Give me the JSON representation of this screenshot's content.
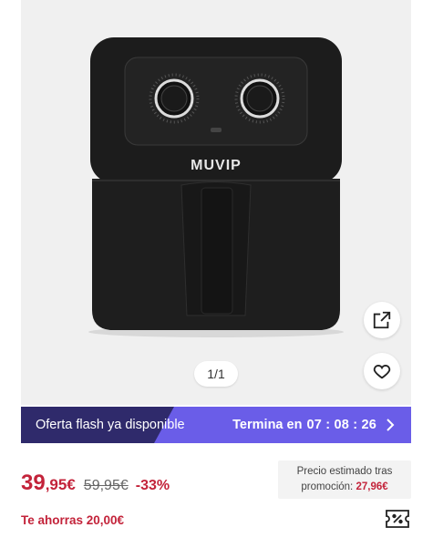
{
  "gallery": {
    "brand_logo_text": "MUVIP",
    "page_indicator": "1/1",
    "share_icon": "external-share-icon",
    "favorite_icon": "heart-outline-icon"
  },
  "flash": {
    "label": "Oferta flash ya disponible",
    "ends_label": "Termina en",
    "timer": "07 : 08 : 26",
    "accent_color": "#6a5de8"
  },
  "price": {
    "integer": "39",
    "decimal": ",95€",
    "old": "59,95€",
    "discount": "-33%"
  },
  "promo": {
    "line1": "Precio estimado tras",
    "line2_label": "promoción:",
    "line2_price": "27,96€"
  },
  "savings": {
    "text": "Te ahorras 20,00€"
  },
  "colors": {
    "price_red": "#c3233a"
  }
}
